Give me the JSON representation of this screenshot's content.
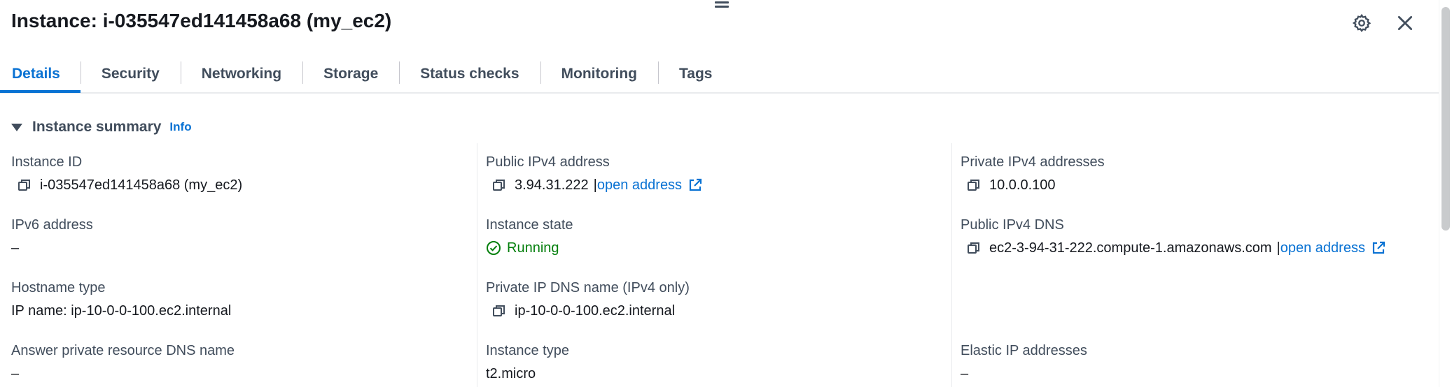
{
  "title": "Instance: i-035547ed141458a68 (my_ec2)",
  "tabs": [
    {
      "label": "Details",
      "active": true
    },
    {
      "label": "Security"
    },
    {
      "label": "Networking"
    },
    {
      "label": "Storage"
    },
    {
      "label": "Status checks"
    },
    {
      "label": "Monitoring"
    },
    {
      "label": "Tags"
    }
  ],
  "section": {
    "title": "Instance summary",
    "info": "Info"
  },
  "fields": {
    "instance_id": {
      "label": "Instance ID",
      "value": "i-035547ed141458a68 (my_ec2)"
    },
    "ipv6": {
      "label": "IPv6 address",
      "value": "–"
    },
    "hostname_type": {
      "label": "Hostname type",
      "value": "IP name: ip-10-0-0-100.ec2.internal"
    },
    "answer_dns": {
      "label": "Answer private resource DNS name",
      "value": "–"
    },
    "public_ipv4": {
      "label": "Public IPv4 address",
      "value": "3.94.31.222",
      "separator": "|",
      "link": "open address"
    },
    "instance_state": {
      "label": "Instance state",
      "value": "Running"
    },
    "private_ip_dns": {
      "label": "Private IP DNS name (IPv4 only)",
      "value": "ip-10-0-0-100.ec2.internal"
    },
    "instance_type": {
      "label": "Instance type",
      "value": "t2.micro"
    },
    "private_ipv4": {
      "label": "Private IPv4 addresses",
      "value": "10.0.0.100"
    },
    "public_dns": {
      "label": "Public IPv4 DNS",
      "value": "ec2-3-94-31-222.compute-1.amazonaws.com",
      "separator": "|",
      "link": "open address"
    },
    "elastic_ip": {
      "label": "Elastic IP addresses",
      "value": "–"
    }
  },
  "colors": {
    "accent": "#0972d3",
    "success": "#037f0c",
    "text": "#16191f",
    "label": "#414d5c"
  }
}
